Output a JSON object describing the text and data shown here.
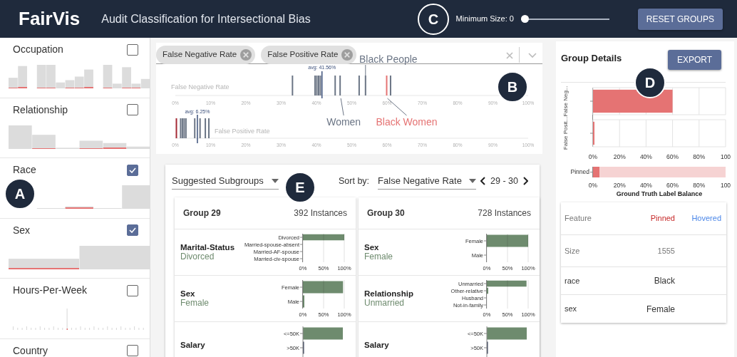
{
  "header": {
    "logo": "FairVis",
    "subtitle": "Audit Classification for Intersectional Bias",
    "callout": "C",
    "min_size": {
      "label": "Minimum Size: 0",
      "level": 0
    },
    "reset_button": "RESET GROUPS"
  },
  "sidebar": {
    "callout": "A",
    "features": [
      {
        "name": "Occupation",
        "checked": false
      },
      {
        "name": "Relationship",
        "checked": false
      },
      {
        "name": "Race",
        "checked": true
      },
      {
        "name": "Sex",
        "checked": true
      },
      {
        "name": "Hours-Per-Week",
        "checked": false
      },
      {
        "name": "Country",
        "checked": false
      }
    ]
  },
  "metrics": {
    "callout": "B",
    "chips": [
      {
        "label": "False Negative Rate"
      },
      {
        "label": "False Positive Rate"
      }
    ],
    "strips": [
      {
        "title": "False Negative Rate",
        "ticks": [
          "0%",
          "10%",
          "20%",
          "30%",
          "40%",
          "50%",
          "60%",
          "70%",
          "80%",
          "90%",
          "100%"
        ],
        "average_label": "avg: 41.56%",
        "labels": [
          {
            "text": "Black People",
            "pinned": false
          },
          {
            "text": "Women",
            "pinned": false
          },
          {
            "text": "Black Women",
            "pinned": true
          }
        ]
      },
      {
        "title": "False Positive Rate",
        "ticks": [
          "0%",
          "10%",
          "20%",
          "30%",
          "40%",
          "50%",
          "60%",
          "70%",
          "80%",
          "90%",
          "100%"
        ],
        "average_label": "avg: 6.25%"
      }
    ]
  },
  "group_details": {
    "title": "Group Details",
    "callout": "D",
    "export_button": "EXPORT",
    "rates_chart": {
      "chart_data": {
        "type": "bar",
        "orientation": "horizontal",
        "grid": true,
        "categories": [
          "False Neg...",
          "False Posit..."
        ],
        "series": [
          {
            "color": "#e57373",
            "values": [
              60,
              1
            ]
          }
        ],
        "xlim": [
          0,
          100
        ],
        "xticks": [
          {
            "value": 0,
            "label": "0%"
          },
          {
            "value": 20,
            "label": "20%"
          },
          {
            "value": 40,
            "label": "40%"
          },
          {
            "value": 60,
            "label": "60%"
          },
          {
            "value": 80,
            "label": "80%"
          },
          {
            "value": 100,
            "label": "100"
          }
        ]
      }
    },
    "balance_chart": {
      "chart_data": {
        "type": "bar",
        "orientation": "horizontal",
        "stacked": true,
        "xlabel": "Ground Truth Label Balance",
        "categories": [
          "Pinned"
        ],
        "series": [
          {
            "color": "#e57373",
            "values": [
              5
            ]
          },
          {
            "color": "#f6d3d3",
            "values": [
              95
            ]
          }
        ],
        "xlim": [
          0,
          100
        ],
        "xticks": [
          {
            "value": 0,
            "label": "0%"
          },
          {
            "value": 20,
            "label": "20%"
          },
          {
            "value": 40,
            "label": "40%"
          },
          {
            "value": 60,
            "label": "60%"
          },
          {
            "value": 80,
            "label": "80%"
          },
          {
            "value": 100,
            "label": "100"
          }
        ]
      }
    },
    "table": {
      "columns": [
        "Feature",
        "Pinned",
        "Hovered"
      ],
      "rows": [
        [
          "Size",
          "1555"
        ],
        [
          "race",
          "Black"
        ],
        [
          "sex",
          "Female"
        ]
      ]
    }
  },
  "subgroups": {
    "callout": "E",
    "list_select": "Suggested Subgroups",
    "sort_label": "Sort by:",
    "sort_select": "False Negative Rate",
    "page": "29 - 30",
    "groups": [
      {
        "title": "Group 29",
        "instances": "392 Instances",
        "features": [
          {
            "name": "Marital-Status",
            "value": "Divorced",
            "chart_data": {
              "type": "bar",
              "orientation": "horizontal",
              "grid": true,
              "categories": [
                "Divorced",
                "Married-spouse-absent",
                "Married-AF-spouse",
                "Married-civ-spouse"
              ],
              "series": [
                {
                  "color": "#6e8b6e",
                  "values": [
                    100,
                    0,
                    0,
                    0
                  ]
                }
              ],
              "xlim": [
                0,
                100
              ],
              "xticks": [
                {
                  "value": 0,
                  "label": "0%"
                },
                {
                  "value": 50,
                  "label": "50%"
                },
                {
                  "value": 100,
                  "label": "100%"
                }
              ]
            }
          },
          {
            "name": "Sex",
            "value": "Female",
            "chart_data": {
              "type": "bar",
              "orientation": "horizontal",
              "grid": true,
              "categories": [
                "Female",
                "Male"
              ],
              "series": [
                {
                  "color": "#6e8b6e",
                  "values": [
                    97,
                    3
                  ]
                }
              ],
              "xlim": [
                0,
                100
              ],
              "xticks": [
                {
                  "value": 0,
                  "label": "0%"
                },
                {
                  "value": 50,
                  "label": "50%"
                },
                {
                  "value": 100,
                  "label": "100%"
                }
              ]
            }
          },
          {
            "name": "Salary",
            "bar_labels": [
              "<=50K",
              ">50K"
            ]
          }
        ]
      },
      {
        "title": "Group 30",
        "instances": "728 Instances",
        "features": [
          {
            "name": "Sex",
            "value": "Female",
            "chart_data": {
              "type": "bar",
              "orientation": "horizontal",
              "grid": true,
              "categories": [
                "Female",
                "Male"
              ],
              "series": [
                {
                  "color": "#6e8b6e",
                  "values": [
                    100,
                    0
                  ]
                }
              ],
              "xlim": [
                0,
                100
              ],
              "xticks": [
                {
                  "value": 0,
                  "label": "0%"
                },
                {
                  "value": 50,
                  "label": "50%"
                },
                {
                  "value": 100,
                  "label": "100%"
                }
              ]
            }
          },
          {
            "name": "Relationship",
            "value": "Unmarried",
            "chart_data": {
              "type": "bar",
              "orientation": "horizontal",
              "grid": true,
              "categories": [
                "Unmarried",
                "Other-relative",
                "Husband",
                "Not-in-family"
              ],
              "series": [
                {
                  "color": "#6e8b6e",
                  "values": [
                    96,
                    2,
                    0,
                    0
                  ]
                }
              ],
              "xlim": [
                0,
                100
              ],
              "xticks": [
                {
                  "value": 0,
                  "label": "0%"
                },
                {
                  "value": 50,
                  "label": "50%"
                },
                {
                  "value": 100,
                  "label": "100%"
                }
              ]
            }
          },
          {
            "name": "Salary",
            "bar_labels": [
              "<=50K",
              ">50K"
            ]
          }
        ]
      }
    ]
  }
}
